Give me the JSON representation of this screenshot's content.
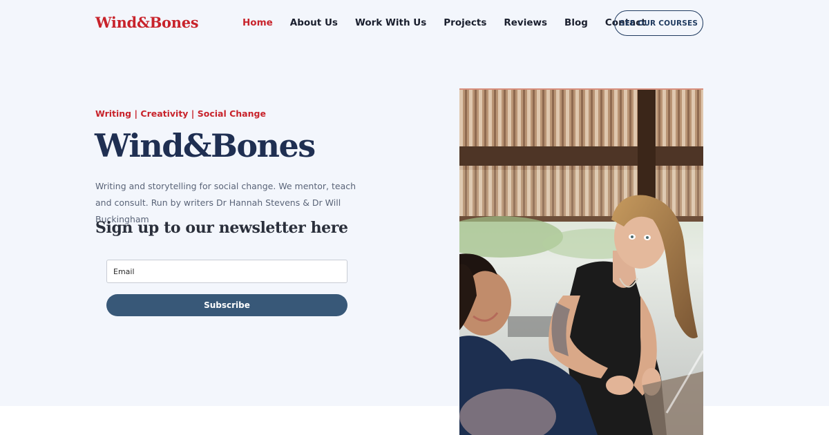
{
  "header": {
    "logo": "Wind&Bones",
    "nav": [
      {
        "label": "Home",
        "active": true
      },
      {
        "label": "About Us",
        "active": false
      },
      {
        "label": "Work With Us",
        "active": false
      },
      {
        "label": "Projects",
        "active": false
      },
      {
        "label": "Reviews",
        "active": false
      },
      {
        "label": "Blog",
        "active": false
      },
      {
        "label": "Contact",
        "active": false
      }
    ],
    "cta_label": "SEE OUR COURSES"
  },
  "hero": {
    "tagline": "Writing | Creativity | Social Change",
    "title": "Wind&Bones",
    "description": "Writing and storytelling for social change. We mentor, teach and consult. Run by writers Dr Hannah Stevens & Dr Will Buckingham",
    "newsletter_heading": "Sign up to our newsletter here"
  },
  "form": {
    "email_placeholder": "Email",
    "subscribe_label": "Subscribe"
  },
  "colors": {
    "accent_red": "#c8232b",
    "navy": "#1f2f52",
    "button_blue": "#385878",
    "page_bg": "#f3f6fc"
  }
}
